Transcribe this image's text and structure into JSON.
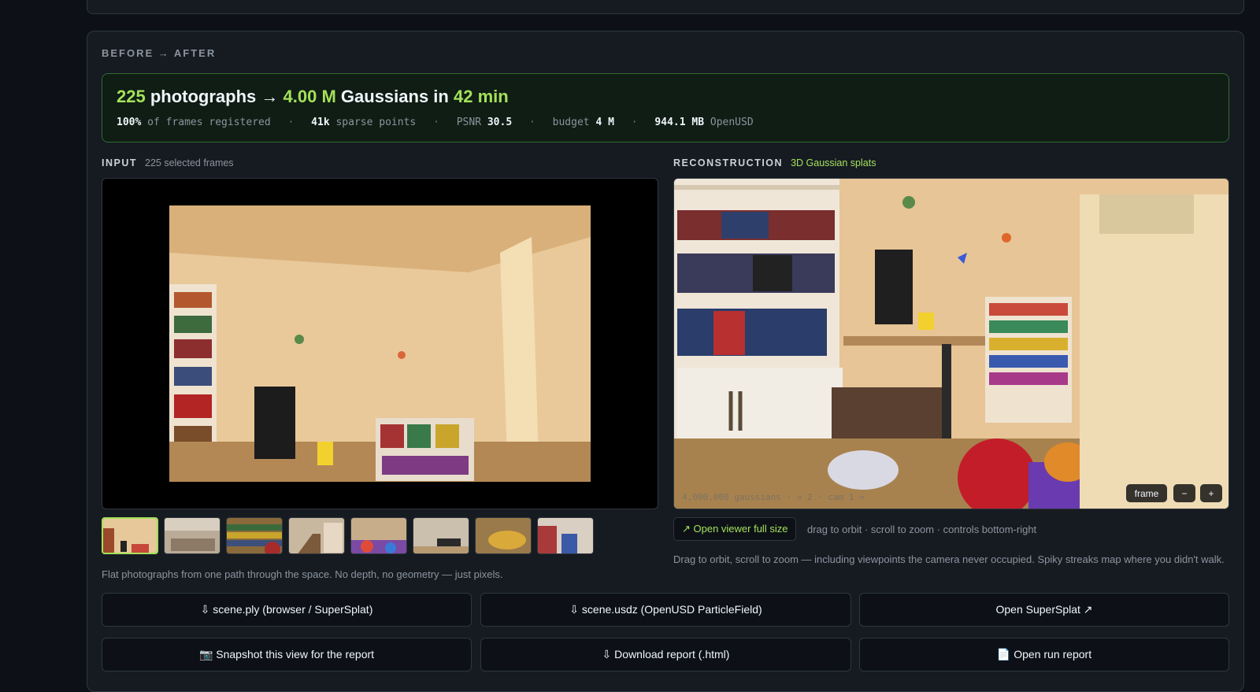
{
  "section": {
    "label": "BEFORE → AFTER"
  },
  "summary": {
    "photos_count": "225",
    "photos_word": "photographs →",
    "gaussians_count": "4.00 M",
    "gaussians_word": "Gaussians in",
    "duration": "42 min",
    "stats": {
      "registered_value": "100%",
      "registered_label": "of frames registered",
      "points_value": "41k",
      "points_label": "sparse points",
      "psnr_label": "PSNR",
      "psnr_value": "30.5",
      "budget_label": "budget",
      "budget_value": "4 M",
      "size_value": "944.1 MB",
      "size_label": "OpenUSD",
      "separator": "·"
    }
  },
  "input": {
    "label": "INPUT",
    "sublabel": "225 selected frames",
    "caption": "Flat photographs from one path through the space. No depth, no geometry — just pixels.",
    "thumb_count": 8
  },
  "reconstruction": {
    "label": "RECONSTRUCTION",
    "sublabel": "3D Gaussian splats",
    "overlay": "4,000,000 gaussians · ▫ 2 · cam 1 ▫",
    "frame_label": "frame",
    "zoom_out_label": "−",
    "zoom_in_label": "+",
    "open_viewer": "↗ Open viewer full size",
    "hint": "drag to orbit · scroll to zoom · controls bottom-right",
    "caption": "Drag to orbit, scroll to zoom — including viewpoints the camera never occupied. Spiky streaks map where you didn't walk."
  },
  "buttons": {
    "ply": "⇩ scene.ply (browser / SuperSplat)",
    "usdz": "⇩ scene.usdz (OpenUSD ParticleField)",
    "supersplat": "Open SuperSplat ↗",
    "snapshot": "📷 Snapshot this view for the report",
    "download_report": "⇩ Download report (.html)",
    "run_report": "📄 Open run report"
  },
  "colors": {
    "accent": "#a5e05a",
    "background": "#0d1117",
    "card": "#161b22",
    "border": "#30363d"
  }
}
